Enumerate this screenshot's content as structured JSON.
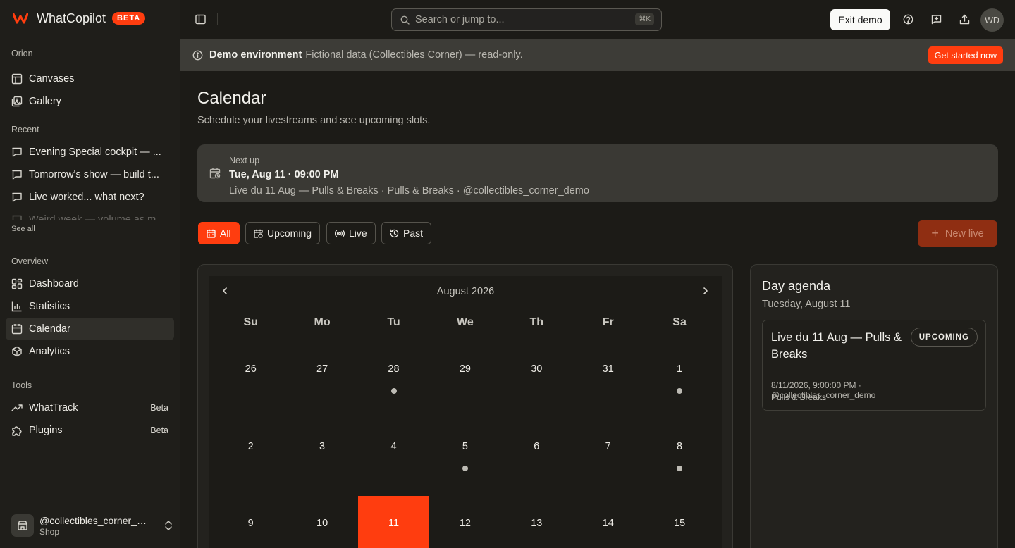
{
  "brand": {
    "name": "WhatCopilot",
    "badge": "BETA"
  },
  "sidebar": {
    "org_heading": "Orion",
    "org_items": [
      {
        "label": "Canvases",
        "icon": "canvas-icon"
      },
      {
        "label": "Gallery",
        "icon": "gallery-icon"
      }
    ],
    "recent_heading": "Recent",
    "recent_items": [
      "Evening Special cockpit — ...",
      "Tomorrow's show — build t...",
      "Live worked... what next?",
      "Weird week — volume as m..."
    ],
    "see_all": "See all",
    "overview_heading": "Overview",
    "overview_items": [
      {
        "label": "Dashboard",
        "icon": "dashboard-icon"
      },
      {
        "label": "Statistics",
        "icon": "bar-chart-icon"
      },
      {
        "label": "Calendar",
        "icon": "calendar-icon",
        "active": true
      },
      {
        "label": "Analytics",
        "icon": "cube-icon"
      }
    ],
    "tools_heading": "Tools",
    "tools_items": [
      {
        "label": "WhatTrack",
        "tag": "Beta",
        "icon": "trending-icon"
      },
      {
        "label": "Plugins",
        "tag": "Beta",
        "icon": "puzzle-icon"
      }
    ],
    "account": {
      "handle": "@collectibles_corner_demo",
      "sub": "Shop"
    }
  },
  "topbar": {
    "search_placeholder": "Search or jump to...",
    "search_shortcut": "⌘K",
    "exit_demo": "Exit demo",
    "avatar_initials": "WD"
  },
  "banner": {
    "title": "Demo environment",
    "text": "Fictional data (Collectibles Corner) — read-only.",
    "cta": "Get started now"
  },
  "page": {
    "title": "Calendar",
    "subtitle": "Schedule your livestreams and see upcoming slots."
  },
  "next_up": {
    "label": "Next up",
    "datetime": "Tue, Aug 11 · 09:00 PM",
    "details": "Live du 11 Aug — Pulls & Breaks · Pulls & Breaks · @collectibles_corner_demo"
  },
  "filters": [
    {
      "label": "All",
      "active": true
    },
    {
      "label": "Upcoming",
      "active": false
    },
    {
      "label": "Live",
      "active": false
    },
    {
      "label": "Past",
      "active": false
    }
  ],
  "new_live": "New live",
  "calendar": {
    "month_label": "August 2026",
    "weekdays": [
      "Su",
      "Mo",
      "Tu",
      "We",
      "Th",
      "Fr",
      "Sa"
    ],
    "weeks": [
      [
        {
          "day": "26"
        },
        {
          "day": "27"
        },
        {
          "day": "28",
          "dot": true
        },
        {
          "day": "29"
        },
        {
          "day": "30"
        },
        {
          "day": "31"
        },
        {
          "day": "1",
          "dot": true
        }
      ],
      [
        {
          "day": "2"
        },
        {
          "day": "3"
        },
        {
          "day": "4"
        },
        {
          "day": "5",
          "dot": true
        },
        {
          "day": "6"
        },
        {
          "day": "7"
        },
        {
          "day": "8",
          "dot": true
        }
      ],
      [
        {
          "day": "9"
        },
        {
          "day": "10"
        },
        {
          "day": "11",
          "selected": true
        },
        {
          "day": "12"
        },
        {
          "day": "13"
        },
        {
          "day": "14"
        },
        {
          "day": "15"
        }
      ]
    ]
  },
  "agenda": {
    "title": "Day agenda",
    "date": "Tuesday, August 11",
    "events": [
      {
        "title": "Live du 11 Aug — Pulls & Breaks",
        "status": "UPCOMING",
        "meta": "8/11/2026, 9:00:00 PM · @collectibles_corner_demo",
        "category": "Pulls & Breaks"
      }
    ]
  },
  "colors": {
    "accent": "#ff3d0f",
    "background": "#1c1b17",
    "surface": "#23221e"
  }
}
